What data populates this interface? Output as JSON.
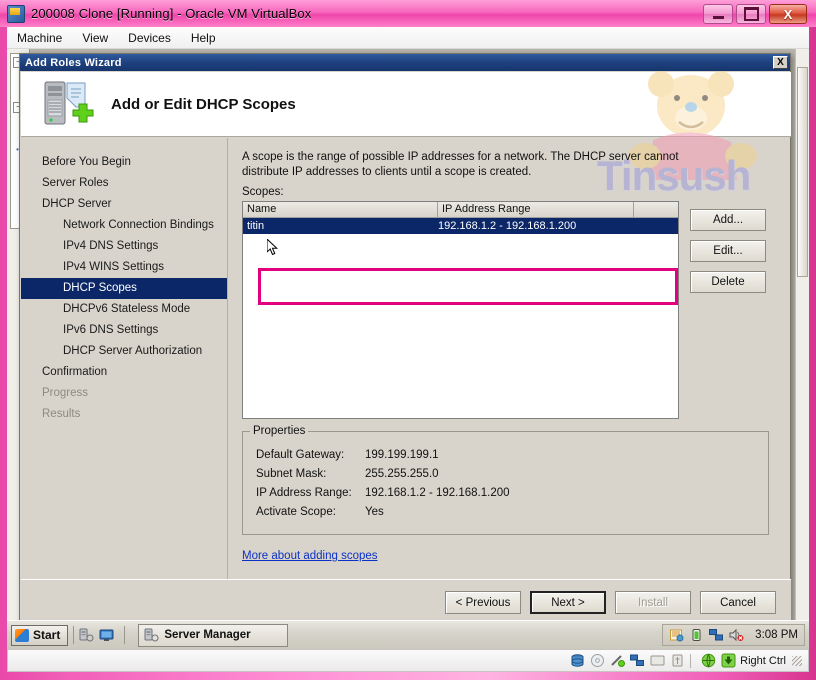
{
  "vbox": {
    "title": "200008 Clone [Running] - Oracle VM VirtualBox",
    "icon": "virtualbox-icon",
    "window_buttons": {
      "minimize": "minimize-icon",
      "maximize": "maximize-icon",
      "close": "X"
    },
    "menus": [
      "Machine",
      "View",
      "Devices",
      "Help"
    ],
    "status_icons": [
      "hard-disk-icon",
      "optical-disk-icon",
      "network-icon",
      "shared-folder-icon",
      "display-icon",
      "usb-icon",
      "mouse-integration-icon",
      "host-key-icon"
    ],
    "host_key": "Right Ctrl"
  },
  "wizard": {
    "title": "Add Roles Wizard",
    "close_label": "X",
    "header": {
      "icon": "server-add-icon",
      "title": "Add or Edit DHCP Scopes"
    },
    "watermark": "Tinsush",
    "nav": [
      {
        "label": "Before You Begin",
        "level": 0,
        "state": "normal"
      },
      {
        "label": "Server Roles",
        "level": 0,
        "state": "normal"
      },
      {
        "label": "DHCP Server",
        "level": 0,
        "state": "normal"
      },
      {
        "label": "Network Connection Bindings",
        "level": 1,
        "state": "normal"
      },
      {
        "label": "IPv4 DNS Settings",
        "level": 1,
        "state": "normal"
      },
      {
        "label": "IPv4 WINS Settings",
        "level": 1,
        "state": "normal"
      },
      {
        "label": "DHCP Scopes",
        "level": 1,
        "state": "selected"
      },
      {
        "label": "DHCPv6 Stateless Mode",
        "level": 1,
        "state": "normal"
      },
      {
        "label": "IPv6 DNS Settings",
        "level": 1,
        "state": "normal"
      },
      {
        "label": "DHCP Server Authorization",
        "level": 1,
        "state": "normal"
      },
      {
        "label": "Confirmation",
        "level": 0,
        "state": "normal"
      },
      {
        "label": "Progress",
        "level": 0,
        "state": "disabled"
      },
      {
        "label": "Results",
        "level": 0,
        "state": "disabled"
      }
    ],
    "content": {
      "intro": "A scope is the range of possible IP addresses for a network. The DHCP server cannot distribute IP addresses to clients until a scope is created.",
      "scopes_label": "Scopes:",
      "columns": [
        "Name",
        "IP Address Range",
        ""
      ],
      "rows": [
        {
          "name": "titin",
          "range": "192.168.1.2 - 192.168.1.200",
          "selected": true
        }
      ],
      "side_buttons": [
        "Add...",
        "Edit...",
        "Delete"
      ],
      "properties": {
        "legend": "Properties",
        "rows": [
          {
            "label": "Default Gateway:",
            "value": "199.199.199.1"
          },
          {
            "label": "Subnet Mask:",
            "value": "255.255.255.0"
          },
          {
            "label": "IP Address Range:",
            "value": "192.168.1.2 - 192.168.1.200"
          },
          {
            "label": "Activate Scope:",
            "value": "Yes"
          }
        ]
      },
      "more_link": "More about adding scopes"
    },
    "footer_buttons": [
      {
        "label": "< Previous",
        "state": "normal"
      },
      {
        "label": "Next >",
        "state": "default"
      },
      {
        "label": "Install",
        "state": "disabled"
      },
      {
        "label": "Cancel",
        "state": "normal"
      }
    ]
  },
  "taskbar": {
    "start_label": "Start",
    "quick_launch": [
      "server-manager-icon",
      "show-desktop-icon"
    ],
    "window_button": {
      "label": "Server Manager",
      "icon": "server-manager-icon"
    },
    "tray_icons": [
      "notification-icon",
      "battery-icon",
      "network-icon",
      "volume-muted-icon"
    ],
    "clock": "3:08 PM"
  },
  "annotation": {
    "color": "#e2007f",
    "target": "selected-scope-row"
  }
}
